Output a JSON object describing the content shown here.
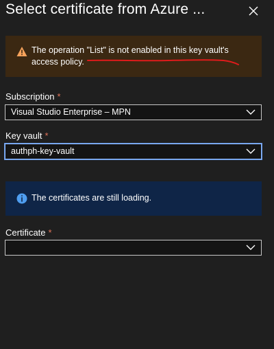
{
  "header": {
    "title": "Select certificate from Azure ..."
  },
  "warning": {
    "icon": "warning-icon",
    "text": "The operation \"List\" is not enabled in this key vault's access policy."
  },
  "fields": {
    "subscription": {
      "label": "Subscription",
      "required_mark": "*",
      "value": "Visual Studio Enterprise – MPN"
    },
    "key_vault": {
      "label": "Key vault",
      "required_mark": "*",
      "value": "authph-key-vault"
    },
    "certificate": {
      "label": "Certificate",
      "required_mark": "*",
      "value": ""
    }
  },
  "info": {
    "icon": "info-icon",
    "text": "The certificates are still loading."
  },
  "colors": {
    "background": "#1f1f1f",
    "warning_bg": "#3b2812",
    "info_bg": "#0f2547",
    "required": "#e0745a",
    "annotation": "#e01b1b",
    "focus": "#8ab4f8"
  }
}
